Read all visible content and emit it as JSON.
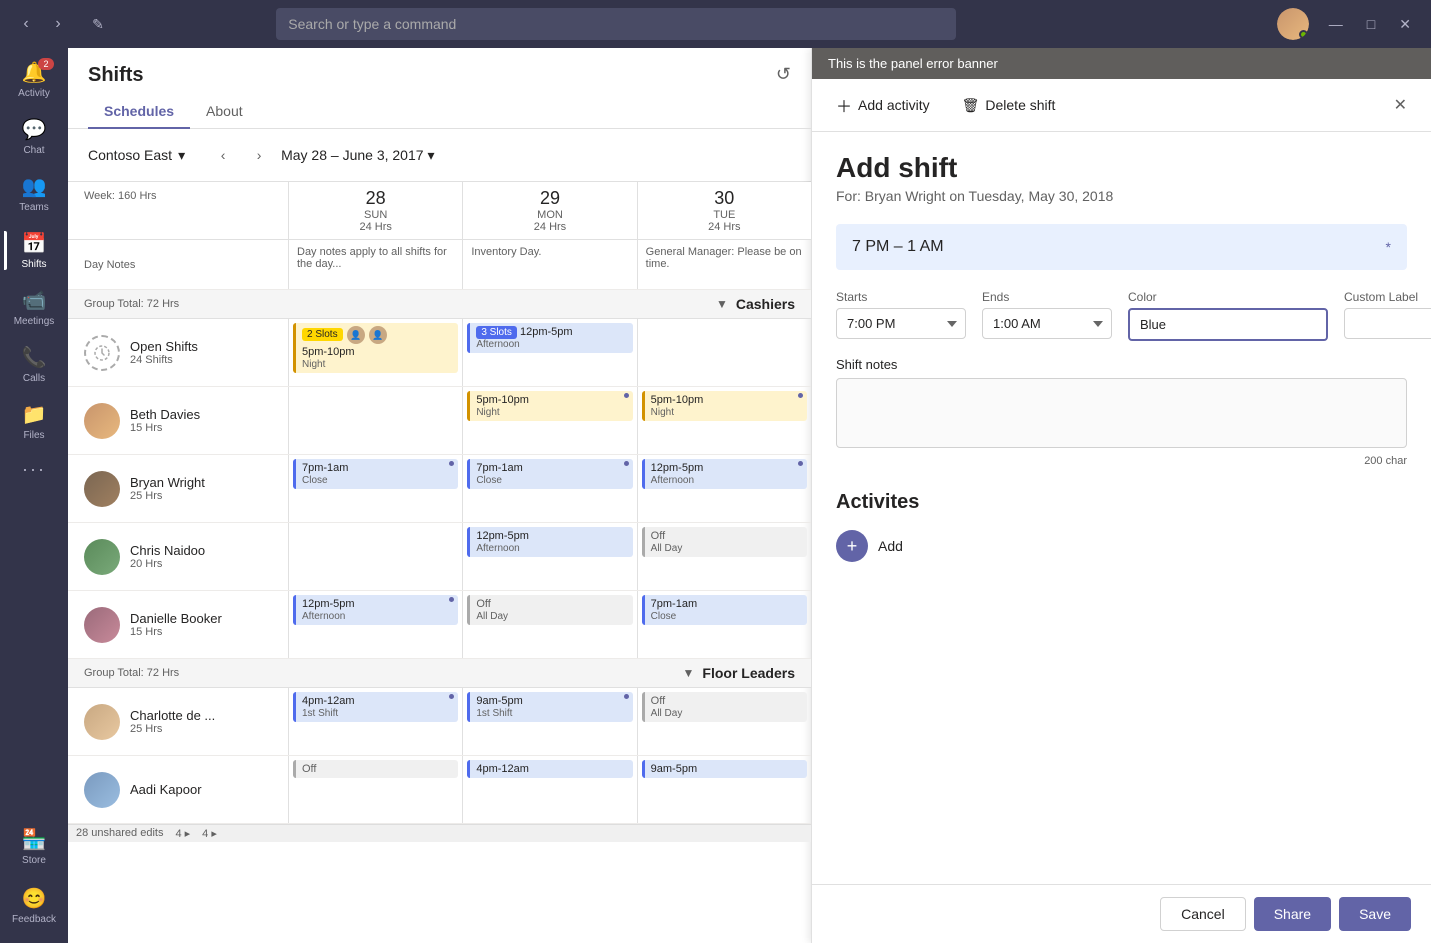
{
  "topbar": {
    "search_placeholder": "Search or type a command",
    "nav_back": "‹",
    "nav_forward": "›",
    "compose_icon": "✎",
    "minimize": "—",
    "maximize": "□",
    "close": "✕"
  },
  "sidebar": {
    "items": [
      {
        "id": "activity",
        "label": "Activity",
        "icon": "🔔",
        "badge": "2"
      },
      {
        "id": "chat",
        "label": "Chat",
        "icon": "💬",
        "badge": ""
      },
      {
        "id": "teams",
        "label": "Teams",
        "icon": "👥",
        "badge": ""
      },
      {
        "id": "shifts",
        "label": "Shifts",
        "icon": "📅",
        "badge": ""
      },
      {
        "id": "meetings",
        "label": "Meetings",
        "icon": "📹",
        "badge": ""
      },
      {
        "id": "calls",
        "label": "Calls",
        "icon": "📞",
        "badge": ""
      },
      {
        "id": "files",
        "label": "Files",
        "icon": "📁",
        "badge": ""
      },
      {
        "id": "more",
        "label": "...",
        "icon": "···",
        "badge": ""
      }
    ],
    "bottom": [
      {
        "id": "store",
        "label": "Store",
        "icon": "🏪"
      },
      {
        "id": "feedback",
        "label": "Feedback",
        "icon": "😊"
      }
    ]
  },
  "page": {
    "title": "Shifts",
    "tabs": [
      {
        "id": "schedules",
        "label": "Schedules"
      },
      {
        "id": "about",
        "label": "About"
      }
    ],
    "active_tab": "schedules"
  },
  "toolbar": {
    "location": "Contoso East",
    "date_range": "May 28 – June 3, 2017",
    "chevron_down": "▾"
  },
  "grid": {
    "columns": [
      {
        "day": "28",
        "dayname": "SUN",
        "hrs": "24 Hrs"
      },
      {
        "day": "29",
        "dayname": "MON",
        "hrs": "24 Hrs"
      },
      {
        "day": "30",
        "dayname": "TUE",
        "hrs": "24 Hrs"
      }
    ],
    "week_label": "Week: 160 Hrs",
    "day_notes_label": "Day Notes",
    "groups": [
      {
        "id": "cashiers",
        "name": "Cashiers",
        "total": "Group Total: 72 Hrs",
        "open_shifts": {
          "label": "Open Shifts",
          "sub": "24 Shifts",
          "slots": [
            {
              "day": 0,
              "text": "2 Slots",
              "time": "5pm-10pm",
              "label": "Night",
              "style": "gold",
              "badges": true
            },
            {
              "day": 1,
              "text": "3 Slots",
              "time": "12pm-5pm",
              "label": "Afternoon",
              "style": "blue"
            }
          ]
        },
        "employees": [
          {
            "name": "Beth Davies",
            "hrs": "15 Hrs",
            "avatar_color": "#c8956c",
            "shifts": [
              {
                "day": 0,
                "time": "",
                "label": ""
              },
              {
                "day": 1,
                "time": "5pm-10pm",
                "label": "Night",
                "style": "gold"
              },
              {
                "day": 2,
                "time": "5pm-10pm",
                "label": "Night",
                "style": "gold"
              }
            ]
          },
          {
            "name": "Bryan Wright",
            "hrs": "25 Hrs",
            "avatar_color": "#7a6652",
            "shifts": [
              {
                "day": 0,
                "time": "7pm-1am",
                "label": "Close",
                "style": "blue"
              },
              {
                "day": 1,
                "time": "7pm-1am",
                "label": "Close",
                "style": "blue"
              },
              {
                "day": 2,
                "time": "12pm-5pm",
                "label": "Afternoon",
                "style": "blue"
              }
            ]
          },
          {
            "name": "Chris Naidoo",
            "hrs": "20 Hrs",
            "avatar_color": "#5a8a5a",
            "shifts": [
              {
                "day": 0,
                "time": "",
                "label": ""
              },
              {
                "day": 1,
                "time": "12pm-5pm",
                "label": "Afternoon",
                "style": "blue"
              },
              {
                "day": 2,
                "time": "Off",
                "label": "All Day",
                "style": "gray"
              }
            ]
          },
          {
            "name": "Danielle Booker",
            "hrs": "15 Hrs",
            "avatar_color": "#9a6a7a",
            "shifts": [
              {
                "day": 0,
                "time": "12pm-5pm",
                "label": "Afternoon",
                "style": "blue"
              },
              {
                "day": 1,
                "time": "Off",
                "label": "All Day",
                "style": "gray"
              },
              {
                "day": 2,
                "time": "7pm-1am",
                "label": "Close",
                "style": "blue"
              }
            ]
          }
        ]
      },
      {
        "id": "floor-leaders",
        "name": "Floor Leaders",
        "total": "Group Total: 72 Hrs",
        "open_shifts": null,
        "employees": [
          {
            "name": "Charlotte de ...",
            "hrs": "25 Hrs",
            "avatar_color": "#c8a882",
            "shifts": [
              {
                "day": 0,
                "time": "4pm-12am",
                "label": "1st Shift",
                "style": "blue"
              },
              {
                "day": 1,
                "time": "9am-5pm",
                "label": "1st Shift",
                "style": "blue"
              },
              {
                "day": 2,
                "time": "Off",
                "label": "All Day",
                "style": "gray"
              }
            ]
          },
          {
            "name": "Aadi Kapoor",
            "hrs": "",
            "avatar_color": "#7a9abf",
            "shifts": [
              {
                "day": 0,
                "time": "Off",
                "label": "",
                "style": "gray"
              },
              {
                "day": 1,
                "time": "4pm-12am",
                "label": "",
                "style": "blue"
              },
              {
                "day": 2,
                "time": "9am-5pm",
                "label": "",
                "style": "blue"
              }
            ]
          }
        ]
      }
    ],
    "day_notes": [
      {
        "day": 0,
        "text": "Day notes apply to all shifts for the day..."
      },
      {
        "day": 1,
        "text": "Inventory Day."
      },
      {
        "day": 2,
        "text": "General Manager: Please be on time."
      }
    ],
    "bottom_bar": {
      "unsaved_edits": "28 unshared edits",
      "actions": [
        "4 ▸",
        "4 ▸"
      ]
    }
  },
  "panel": {
    "error_banner": "This is the panel error banner",
    "add_activity_btn": "Add activity",
    "delete_shift_btn": "Delete shift",
    "title": "Add shift",
    "subtitle": "For: Bryan Wright on Tuesday, May 30, 2018",
    "time_display": "7 PM – 1 AM",
    "starts_label": "Starts",
    "starts_value": "7:00 PM",
    "ends_label": "Ends",
    "ends_value": "1:00 AM",
    "color_label": "Color",
    "color_value": "Blue",
    "custom_label": "Custom Label",
    "custom_value": "",
    "shift_notes_label": "Shift notes",
    "char_count": "200 char",
    "activities_title": "Activites",
    "add_label": "Add",
    "cancel_btn": "Cancel",
    "share_btn": "Share",
    "save_btn": "Save"
  }
}
